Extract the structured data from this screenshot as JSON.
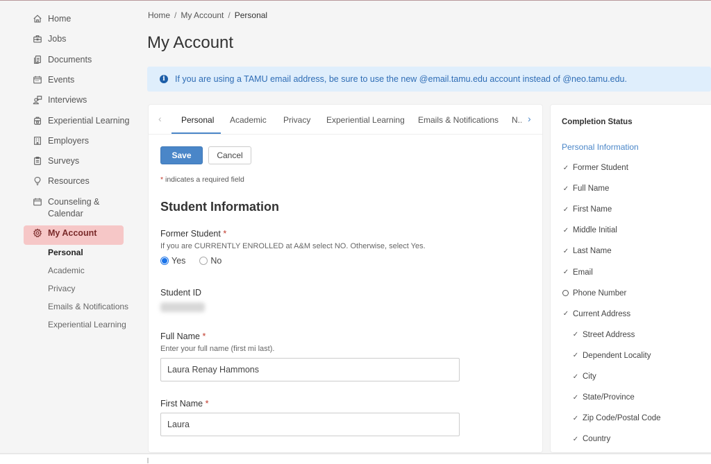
{
  "sidebar": {
    "items": [
      {
        "label": "Home",
        "icon": "home-icon"
      },
      {
        "label": "Jobs",
        "icon": "briefcase-icon"
      },
      {
        "label": "Documents",
        "icon": "documents-icon"
      },
      {
        "label": "Events",
        "icon": "calendar-icon"
      },
      {
        "label": "Interviews",
        "icon": "interviews-icon"
      },
      {
        "label": "Experiential Learning",
        "icon": "backpack-icon"
      },
      {
        "label": "Employers",
        "icon": "building-icon"
      },
      {
        "label": "Surveys",
        "icon": "clipboard-icon"
      },
      {
        "label": "Resources",
        "icon": "lightbulb-icon"
      },
      {
        "label": "Counseling &",
        "label2": "Calendar",
        "icon": "calendar-icon"
      },
      {
        "label": "My Account",
        "icon": "gear-icon"
      }
    ],
    "sub_items": [
      {
        "label": "Personal"
      },
      {
        "label": "Academic"
      },
      {
        "label": "Privacy"
      },
      {
        "label": "Emails & Notifications"
      },
      {
        "label": "Experiential Learning"
      }
    ]
  },
  "breadcrumb": {
    "items": [
      "Home",
      "My Account",
      "Personal"
    ],
    "separator": "/"
  },
  "page": {
    "title": "My Account"
  },
  "alert": {
    "text": "If you are using a TAMU email address, be sure to use the new @email.tamu.edu account instead of @neo.tamu.edu.",
    "icon": "info-icon"
  },
  "tabs": {
    "items": [
      "Personal",
      "Academic",
      "Privacy",
      "Experiential Learning",
      "Emails & Notifications",
      "N..."
    ],
    "active": "Personal",
    "prev": "‹",
    "next": "›"
  },
  "form": {
    "save_label": "Save",
    "cancel_label": "Cancel",
    "required_star": "*",
    "required_note": " indicates a required field",
    "section_title": "Student Information",
    "former_student": {
      "label": "Former Student",
      "help": "If you are CURRENTLY ENROLLED at A&M select NO. Otherwise, select Yes.",
      "options": [
        "Yes",
        "No"
      ],
      "selected": "Yes"
    },
    "student_id": {
      "label": "Student ID"
    },
    "full_name": {
      "label": "Full Name",
      "help": "Enter your full name (first mi last).",
      "value": "Laura Renay Hammons"
    },
    "first_name": {
      "label": "First Name",
      "value": "Laura"
    }
  },
  "completion": {
    "title": "Completion Status",
    "section": "Personal Information",
    "items": [
      {
        "label": "Former Student",
        "done": true,
        "indent": false
      },
      {
        "label": "Full Name",
        "done": true,
        "indent": false
      },
      {
        "label": "First Name",
        "done": true,
        "indent": false
      },
      {
        "label": "Middle Initial",
        "done": true,
        "indent": false
      },
      {
        "label": "Last Name",
        "done": true,
        "indent": false
      },
      {
        "label": "Email",
        "done": true,
        "indent": false
      },
      {
        "label": "Phone Number",
        "done": false,
        "indent": false
      },
      {
        "label": "Current Address",
        "done": true,
        "indent": false
      },
      {
        "label": "Street Address",
        "done": true,
        "indent": true
      },
      {
        "label": "Dependent Locality",
        "done": true,
        "indent": true
      },
      {
        "label": "City",
        "done": true,
        "indent": true
      },
      {
        "label": "State/Province",
        "done": true,
        "indent": true
      },
      {
        "label": "Zip Code/Postal Code",
        "done": true,
        "indent": true
      },
      {
        "label": "Country",
        "done": true,
        "indent": true
      }
    ]
  },
  "colors": {
    "accent": "#4a86c8",
    "active_nav_bg": "#f6c7c7",
    "alert_bg": "#dfeefc",
    "required": "#c0392b"
  }
}
